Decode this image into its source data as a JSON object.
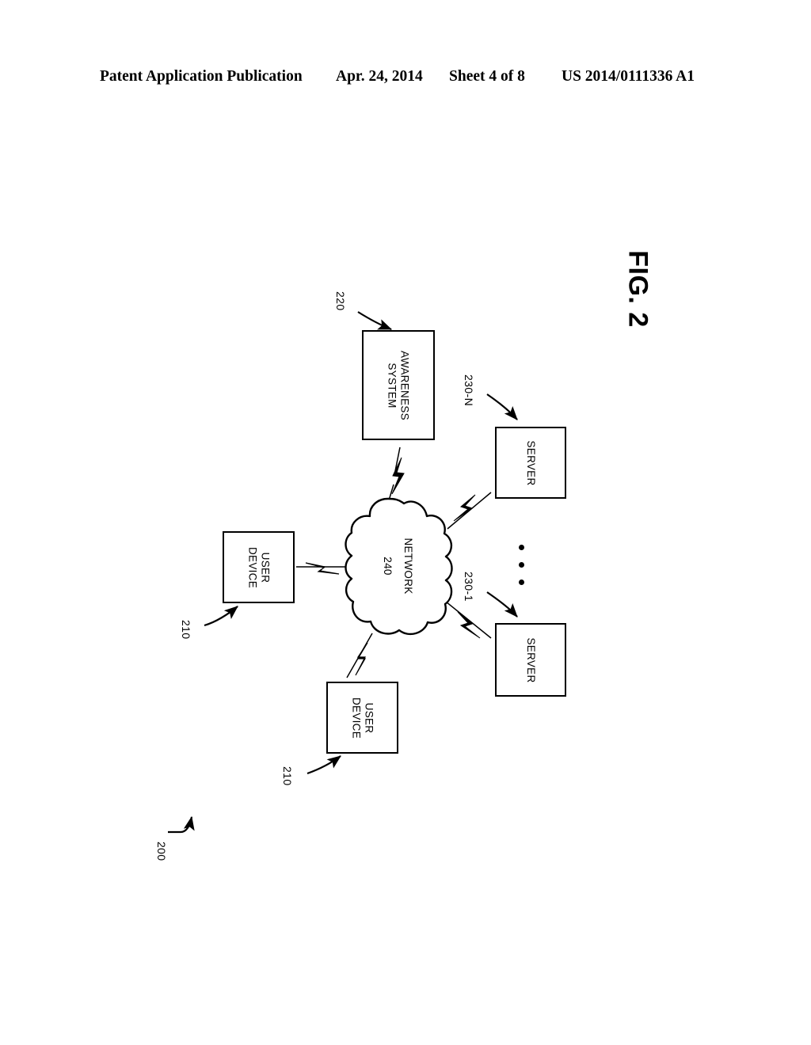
{
  "header": {
    "publication": "Patent Application Publication",
    "date": "Apr. 24, 2014",
    "sheet": "Sheet 4 of 8",
    "publication_number": "US 2014/0111336 A1"
  },
  "figure": {
    "caption": "FIG. 2",
    "system_reference": "200",
    "nodes": [
      {
        "id": "awareness-system",
        "label": "AWARENESS\nSYSTEM",
        "reference": "220",
        "shape": "rectangle"
      },
      {
        "id": "server-n",
        "label": "SERVER",
        "reference": "230-N",
        "shape": "rectangle"
      },
      {
        "id": "server-1",
        "label": "SERVER",
        "reference": "230-1",
        "shape": "rectangle"
      },
      {
        "id": "user-device-1",
        "label": "USER\nDEVICE",
        "reference": "210",
        "shape": "rectangle"
      },
      {
        "id": "user-device-2",
        "label": "USER\nDEVICE",
        "reference": "210",
        "shape": "rectangle"
      },
      {
        "id": "network",
        "label": "NETWORK",
        "reference": "240",
        "shape": "cloud"
      }
    ],
    "links": [
      {
        "from": "network",
        "to": "awareness-system",
        "type": "wireless"
      },
      {
        "from": "network",
        "to": "server-n",
        "type": "wireless"
      },
      {
        "from": "network",
        "to": "server-1",
        "type": "wireless"
      },
      {
        "from": "network",
        "to": "user-device-1",
        "type": "wireless"
      },
      {
        "from": "network",
        "to": "user-device-2",
        "type": "wireless"
      }
    ],
    "ellipsis": "⋮",
    "colors": {
      "ink": "#000000",
      "background": "#ffffff"
    }
  },
  "labels": {
    "awareness_line1": "AWARENESS",
    "awareness_line2": "SYSTEM",
    "server_n": "SERVER",
    "server_1": "SERVER",
    "user_device_1_line1": "USER",
    "user_device_1_line2": "DEVICE",
    "user_device_2_line1": "USER",
    "user_device_2_line2": "DEVICE",
    "network_name": "NETWORK",
    "network_ref": "240"
  },
  "references": {
    "awareness": "220",
    "server_n": "230-N",
    "server_1": "230-1",
    "user_device_1": "210",
    "user_device_2": "210",
    "system": "200"
  }
}
